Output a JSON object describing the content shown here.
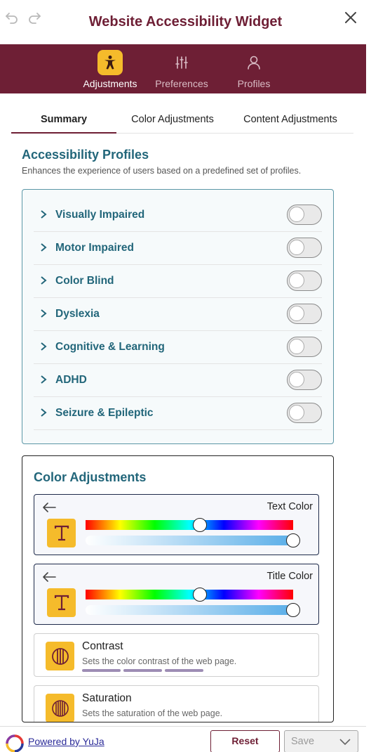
{
  "header": {
    "title": "Website Accessibility Widget",
    "undo_icon": "undo-icon",
    "redo_icon": "redo-icon",
    "close_icon": "close-icon"
  },
  "nav": {
    "items": [
      {
        "label": "Adjustments",
        "icon": "accessibility-person-icon",
        "active": true
      },
      {
        "label": "Preferences",
        "icon": "sliders-icon",
        "active": false
      },
      {
        "label": "Profiles",
        "icon": "user-icon",
        "active": false
      }
    ]
  },
  "tabs": [
    {
      "label": "Summary",
      "active": true
    },
    {
      "label": "Color Adjustments",
      "active": false
    },
    {
      "label": "Content Adjustments",
      "active": false
    }
  ],
  "profiles_section": {
    "title": "Accessibility Profiles",
    "subtitle": "Enhances the experience of users based on a predefined set of profiles.",
    "items": [
      {
        "label": "Visually Impaired",
        "enabled": false
      },
      {
        "label": "Motor Impaired",
        "enabled": false
      },
      {
        "label": "Color Blind",
        "enabled": false
      },
      {
        "label": "Dyslexia",
        "enabled": false
      },
      {
        "label": "Cognitive & Learning",
        "enabled": false
      },
      {
        "label": "ADHD",
        "enabled": false
      },
      {
        "label": "Seizure & Epileptic",
        "enabled": false
      }
    ]
  },
  "color_section": {
    "title": "Color Adjustments",
    "pickers": [
      {
        "label": "Text Color",
        "hue": 0.55,
        "lightness": 1.0
      },
      {
        "label": "Title Color",
        "hue": 0.55,
        "lightness": 1.0
      }
    ],
    "options": [
      {
        "title": "Contrast",
        "subtitle": "Sets the color contrast of the web page.",
        "icon": "contrast-icon",
        "steps": 3
      },
      {
        "title": "Saturation",
        "subtitle": "Sets the saturation of the web page.",
        "icon": "saturation-icon"
      }
    ]
  },
  "footer": {
    "powered_by": "Powered by YuJa",
    "reset_label": "Reset",
    "save_label": "Save"
  },
  "colors": {
    "brand": "#6e1f35",
    "accent": "#f5bb2b",
    "teal": "#22667a"
  }
}
